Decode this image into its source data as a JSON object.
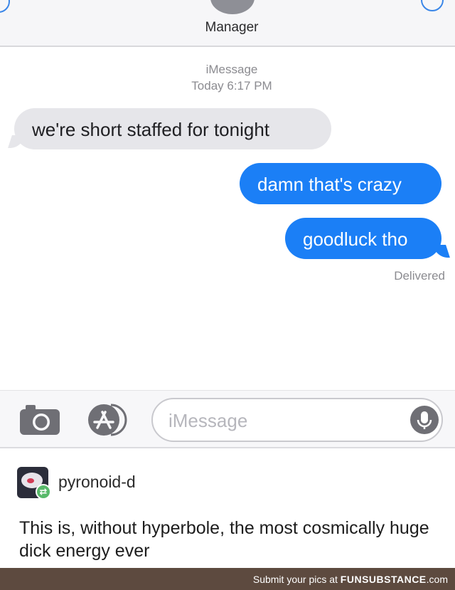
{
  "header": {
    "contact_name": "Manager"
  },
  "conversation": {
    "service": "iMessage",
    "timestamp": "Today 6:17 PM",
    "messages": [
      {
        "direction": "incoming",
        "text": "we're short staffed for tonight"
      },
      {
        "direction": "outgoing",
        "text": "damn that's crazy"
      },
      {
        "direction": "outgoing",
        "text": "goodluck tho"
      }
    ],
    "status": "Delivered"
  },
  "input_bar": {
    "placeholder": "iMessage"
  },
  "comment": {
    "username": "pyronoid-d",
    "text": "This is, without hyperbole, the most cosmically huge dick energy ever"
  },
  "footer": {
    "prefix": "Submit your pics at ",
    "brand_bold": "FUNSUBSTANCE",
    "brand_suffix": ".com"
  },
  "colors": {
    "outgoing_bubble": "#1b7ff6",
    "incoming_bubble": "#e6e6ea",
    "footer_bg": "#5d4a3f",
    "accent": "#3a86e8"
  },
  "icons": [
    "back-icon",
    "info-icon",
    "camera-icon",
    "app-store-icon",
    "microphone-icon",
    "reblog-icon"
  ]
}
